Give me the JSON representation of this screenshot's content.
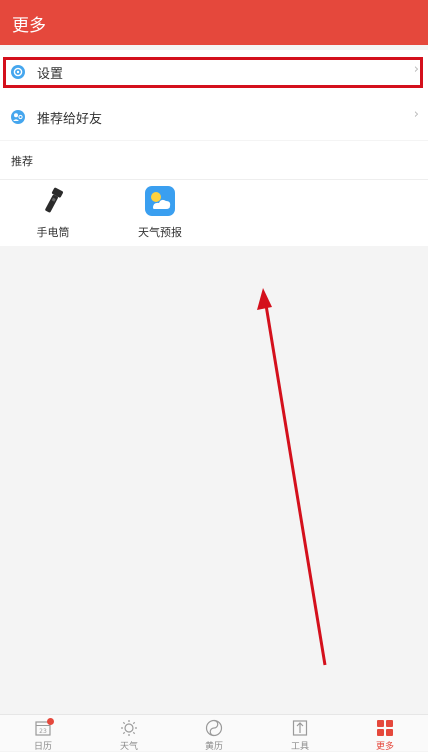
{
  "header": {
    "title": "更多"
  },
  "menu": {
    "items": [
      {
        "label": "设置",
        "chevron": "›",
        "icon": "gear-icon",
        "highlighted": true
      },
      {
        "label": "推荐给好友",
        "chevron": "›",
        "icon": "share-friends-icon",
        "highlighted": false
      }
    ]
  },
  "recommend": {
    "title": "推荐",
    "apps": [
      {
        "label": "手电筒",
        "icon": "flashlight-icon"
      },
      {
        "label": "天气预报",
        "icon": "weather-app-icon"
      }
    ]
  },
  "tabbar": {
    "tabs": [
      {
        "label": "日历",
        "icon": "calendar-icon",
        "icon_text": "23",
        "badge": true,
        "active": false
      },
      {
        "label": "天气",
        "icon": "sun-icon",
        "active": false
      },
      {
        "label": "黄历",
        "icon": "almanac-icon",
        "active": false
      },
      {
        "label": "工具",
        "icon": "tools-icon",
        "active": false
      },
      {
        "label": "更多",
        "icon": "more-grid-icon",
        "active": true
      }
    ]
  },
  "colors": {
    "accent": "#e5483c",
    "highlight_box": "#d4101c",
    "menu_icon": "#45a6ee"
  }
}
